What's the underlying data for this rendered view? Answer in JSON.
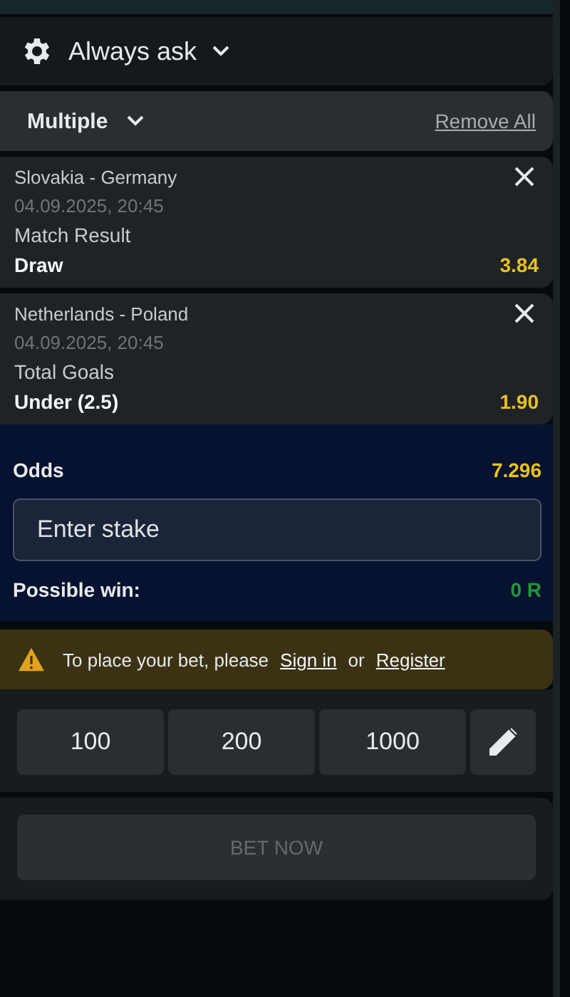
{
  "settings": {
    "label": "Always ask"
  },
  "betslip": {
    "type_label": "Multiple",
    "remove_all": "Remove All"
  },
  "selections": [
    {
      "match": "Slovakia - Germany",
      "datetime": "04.09.2025, 20:45",
      "market": "Match Result",
      "pick": "Draw",
      "odds": "3.84"
    },
    {
      "match": "Netherlands - Poland",
      "datetime": "04.09.2025, 20:45",
      "market": "Total Goals",
      "pick": "Under (2.5)",
      "odds": "1.90"
    }
  ],
  "summary": {
    "odds_label": "Odds",
    "odds": "7.296",
    "stake": {
      "placeholder": "Enter stake"
    },
    "win_label": "Possible win:",
    "win": "0 R"
  },
  "notice": {
    "text": "To place your bet, please",
    "sign_in": "Sign in",
    "or": "or",
    "register": "Register"
  },
  "quick_stakes": [
    "100",
    "200",
    "1000"
  ],
  "bet_button": {
    "label": "BET NOW",
    "disabled": true
  }
}
